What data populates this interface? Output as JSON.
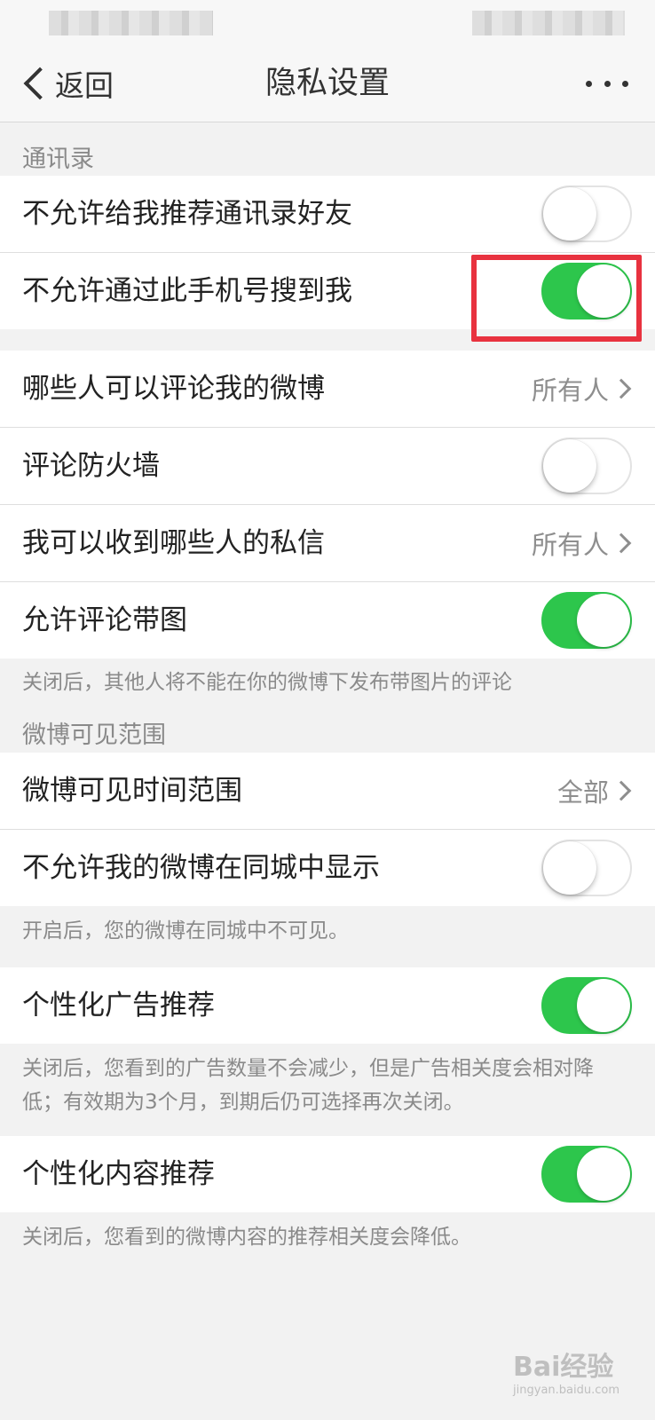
{
  "nav": {
    "back_label": "返回",
    "title": "隐私设置"
  },
  "sections": {
    "contacts_header": "通讯录",
    "weibo_range_header": "微博可见范围"
  },
  "rows": {
    "no_recommend_contacts": {
      "label": "不允许给我推荐通讯录好友",
      "on": false
    },
    "no_search_by_phone": {
      "label": "不允许通过此手机号搜到我",
      "on": true
    },
    "who_can_comment": {
      "label": "哪些人可以评论我的微博",
      "value": "所有人"
    },
    "comment_firewall": {
      "label": "评论防火墙",
      "on": false
    },
    "who_can_message": {
      "label": "我可以收到哪些人的私信",
      "value": "所有人"
    },
    "allow_comment_images": {
      "label": "允许评论带图",
      "on": true
    },
    "weibo_visible_time": {
      "label": "微博可见时间范围",
      "value": "全部"
    },
    "hide_in_same_city": {
      "label": "不允许我的微博在同城中显示",
      "on": false
    },
    "personalized_ads": {
      "label": "个性化广告推荐",
      "on": true
    },
    "personalized_content": {
      "label": "个性化内容推荐",
      "on": true
    }
  },
  "hints": {
    "comment_images": "关闭后，其他人将不能在你的微博下发布带图片的评论",
    "same_city": "开启后，您的微博在同城中不可见。",
    "ads_line1": "关闭后，您看到的广告数量不会减少，但是广告相关度会相对降",
    "ads_line2": "低；有效期为3个月，到期后仍可选择再次关闭。",
    "content": "关闭后，您看到的微博内容的推荐相关度会降低。"
  },
  "watermark": {
    "brand": "Bai经验",
    "url": "jingyan.baidu.com"
  },
  "colors": {
    "toggle_on": "#2dc64c",
    "highlight": "#e8323f"
  }
}
